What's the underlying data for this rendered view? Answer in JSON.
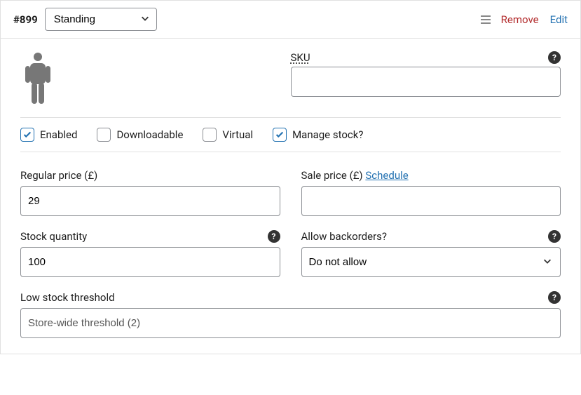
{
  "header": {
    "id": "#899",
    "attribute_selected": "Standing",
    "attribute_options": [
      "Standing"
    ],
    "remove": "Remove",
    "edit": "Edit"
  },
  "sku": {
    "label": "SKU",
    "value": ""
  },
  "checks": {
    "enabled": {
      "label": "Enabled",
      "checked": true
    },
    "downloadable": {
      "label": "Downloadable",
      "checked": false
    },
    "virtual": {
      "label": "Virtual",
      "checked": false
    },
    "manage_stock": {
      "label": "Manage stock?",
      "checked": true
    }
  },
  "regular_price": {
    "label": "Regular price (£)",
    "value": "29"
  },
  "sale_price": {
    "label": "Sale price (£)",
    "schedule": "Schedule",
    "value": ""
  },
  "stock_qty": {
    "label": "Stock quantity",
    "value": "100"
  },
  "backorders": {
    "label": "Allow backorders?",
    "selected": "Do not allow",
    "options": [
      "Do not allow"
    ]
  },
  "low_stock": {
    "label": "Low stock threshold",
    "placeholder": "Store-wide threshold (2)",
    "value": ""
  }
}
